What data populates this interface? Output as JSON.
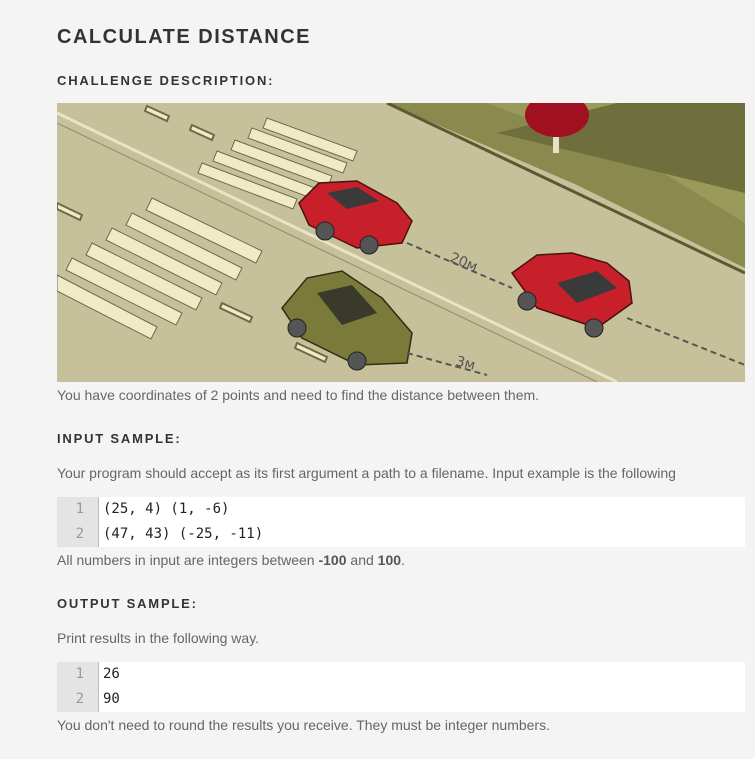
{
  "title": "CALCULATE DISTANCE",
  "sections": {
    "description_head": "CHALLENGE DESCRIPTION:",
    "description_text": "You have coordinates of 2 points and need to find the distance between them.",
    "input_head": "INPUT SAMPLE:",
    "input_text": "Your program should accept as its first argument a path to a filename. Input example is the following",
    "input_note_prefix": "All numbers in input are integers between ",
    "input_note_min": "-100",
    "input_note_mid": " and ",
    "input_note_max": "100",
    "input_note_suffix": ".",
    "output_head": "OUTPUT SAMPLE:",
    "output_text": "Print results in the following way.",
    "output_note": "You don't need to round the results you receive. They must be integer numbers."
  },
  "illustration": {
    "label_far": "20м",
    "label_near": "3м",
    "colors": {
      "road": "#c6c19a",
      "grass": "#8a8a4e",
      "red_car": "#c8202a",
      "olive_car": "#7a7a3a",
      "tree": "#a01020"
    }
  },
  "input_code": [
    {
      "num": "1",
      "code": "(25, 4) (1, -6)"
    },
    {
      "num": "2",
      "code": "(47, 43) (-25, -11)"
    }
  ],
  "output_code": [
    {
      "num": "1",
      "code": "26"
    },
    {
      "num": "2",
      "code": "90"
    }
  ]
}
